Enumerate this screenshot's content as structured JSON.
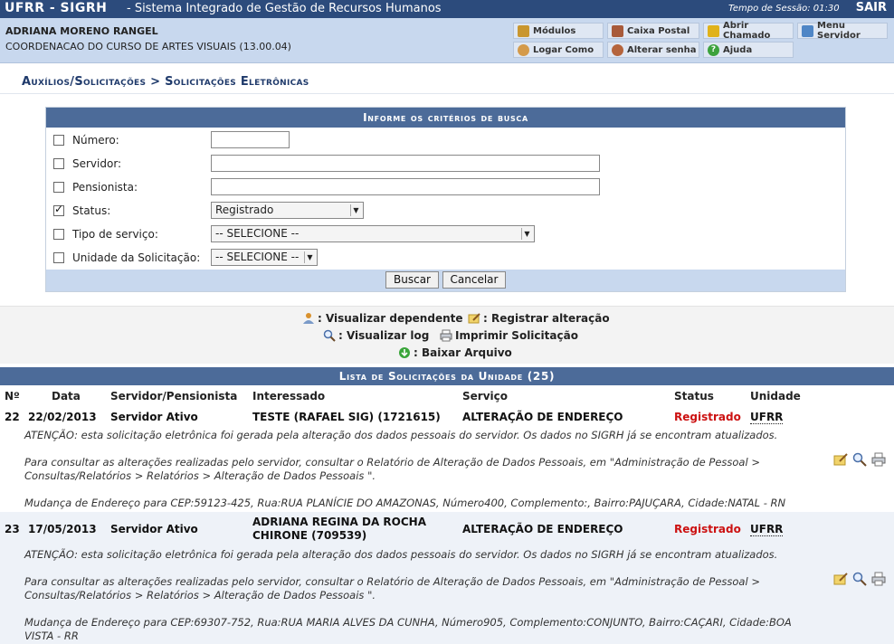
{
  "topbar": {
    "system": "UFRR - SIGRH",
    "system_name": "- Sistema Integrado de Gestão de Recursos Humanos",
    "session": "Tempo de Sessão: 01:30",
    "logout": "SAIR"
  },
  "user": {
    "name": "ADRIANA MORENO RANGEL",
    "unit": "COORDENACAO DO CURSO DE ARTES VISUAIS (13.00.04)"
  },
  "quick_menu": {
    "modulos": "Módulos",
    "caixa_postal": "Caixa Postal",
    "abrir_chamado": "Abrir Chamado",
    "menu_servidor": "Menu Servidor",
    "logar_como": "Logar Como",
    "alterar_senha": "Alterar senha",
    "ajuda": "Ajuda"
  },
  "breadcrumb": "Auxílios/Solicitações > Solicitações Eletrônicas",
  "search": {
    "caption": "Informe os critérios de busca",
    "fields": {
      "numero": {
        "label": "Número:",
        "checked": false,
        "value": ""
      },
      "servidor": {
        "label": "Servidor:",
        "checked": false,
        "value": ""
      },
      "pensionista": {
        "label": "Pensionista:",
        "checked": false,
        "value": ""
      },
      "status": {
        "label": "Status:",
        "checked": true,
        "value": "Registrado"
      },
      "tipo_servico": {
        "label": "Tipo de serviço:",
        "checked": false,
        "value": "-- SELECIONE --"
      },
      "unidade": {
        "label": "Unidade da Solicitação:",
        "checked": false,
        "value": "-- SELECIONE --"
      }
    },
    "buscar": "Buscar",
    "cancelar": "Cancelar"
  },
  "legend": {
    "visualizar_dependente": ": Visualizar dependente",
    "registrar_alteracao": ": Registrar alteração",
    "visualizar_log": ": Visualizar log",
    "imprimir": "Imprimir Solicitação",
    "baixar": ": Baixar Arquivo"
  },
  "list": {
    "caption": "Lista de Solicitações da Unidade (25)",
    "columns": [
      "Nº",
      "Data",
      "Servidor/Pensionista",
      "Interessado",
      "Serviço",
      "Status",
      "Unidade"
    ],
    "rows": [
      {
        "numero": "22",
        "data": "22/02/2013",
        "servidor": "Servidor Ativo",
        "interessado_1": "TESTE (RAFAEL SIG) (1721615)",
        "interessado_2": "",
        "servico": "ALTERAÇÃO DE ENDEREÇO",
        "status": "Registrado",
        "unidade": "UFRR",
        "note1": "ATENÇÃO: esta solicitação eletrônica foi gerada pela alteração dos dados pessoais do servidor. Os dados no SIGRH já se encontram atualizados.",
        "note2a": "Para consultar as alterações realizadas pelo servidor, consultar o Relatório de Alteração de Dados Pessoais, em \"Administração de Pessoal >",
        "note2b": "Consultas/Relatórios > Relatórios > Alteração de Dados Pessoais \".",
        "note3a": "Mudança de Endereço para CEP:59123-425, Rua:RUA PLANÍCIE DO AMAZONAS, Número400, Complemento:, Bairro:PAJUÇARA, Cidade:NATAL - RN",
        "note3b": ""
      },
      {
        "numero": "23",
        "data": "17/05/2013",
        "servidor": "Servidor Ativo",
        "interessado_1": "ADRIANA REGINA DA ROCHA",
        "interessado_2": "CHIRONE (709539)",
        "servico": "ALTERAÇÃO DE ENDEREÇO",
        "status": "Registrado",
        "unidade": "UFRR",
        "note1": "ATENÇÃO: esta solicitação eletrônica foi gerada pela alteração dos dados pessoais do servidor. Os dados no SIGRH já se encontram atualizados.",
        "note2a": "Para consultar as alterações realizadas pelo servidor, consultar o Relatório de Alteração de Dados Pessoais, em \"Administração de Pessoal >",
        "note2b": "Consultas/Relatórios > Relatórios > Alteração de Dados Pessoais \".",
        "note3a": "Mudança de Endereço para CEP:69307-752, Rua:RUA MARIA ALVES DA CUNHA, Número905, Complemento:CONJUNTO, Bairro:CAÇARI, Cidade:BOA",
        "note3b": "VISTA - RR"
      }
    ]
  },
  "colors": {
    "header_blue": "#2c4b7c",
    "caption_blue": "#4c6b99",
    "light_blue": "#c8d8ee",
    "status_red": "#cc1111"
  }
}
